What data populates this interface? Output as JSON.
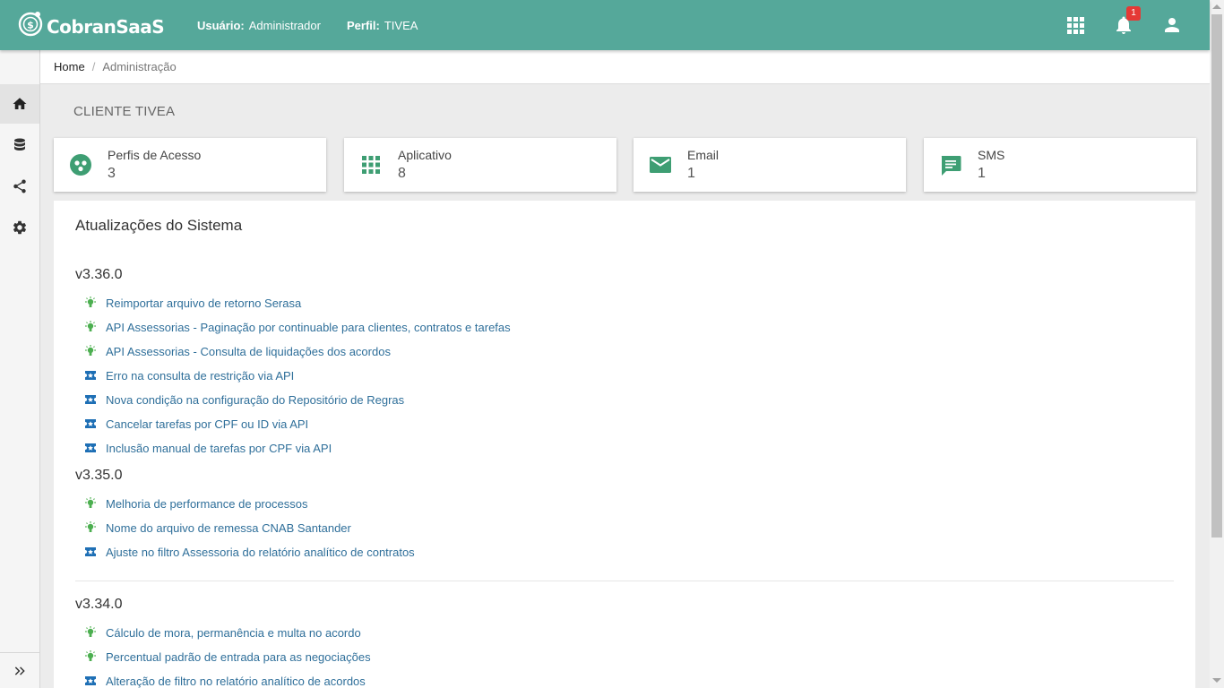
{
  "header": {
    "brand": "CobranSaaS",
    "user_label": "Usuário:",
    "user_value": "Administrador",
    "profile_label": "Perfil:",
    "profile_value": "TIVEA",
    "notifications_count": "1",
    "icons": [
      "apps-grid-icon",
      "bell-icon",
      "account-icon"
    ]
  },
  "sidebar": {
    "items": [
      {
        "name": "home",
        "icon": "home-icon",
        "active": true
      },
      {
        "name": "database",
        "icon": "database-icon"
      },
      {
        "name": "share",
        "icon": "share-icon"
      },
      {
        "name": "settings",
        "icon": "gear-icon"
      }
    ],
    "expand_icon": "double-chevron-right-icon"
  },
  "breadcrumb": {
    "home": "Home",
    "separator": "/",
    "current": "Administração"
  },
  "client_title": "CLIENTE TIVEA",
  "cards": [
    {
      "label": "Perfis de Acesso",
      "value": "3",
      "icon": "group-circle-icon"
    },
    {
      "label": "Aplicativo",
      "value": "8",
      "icon": "apps-grid-icon"
    },
    {
      "label": "Email",
      "value": "1",
      "icon": "mail-icon"
    },
    {
      "label": "SMS",
      "value": "1",
      "icon": "chat-icon"
    }
  ],
  "updates": {
    "title": "Atualizações do Sistema",
    "versions": [
      {
        "version": "v3.36.0",
        "items": [
          {
            "type": "feature",
            "text": "Reimportar arquivo de retorno Serasa"
          },
          {
            "type": "feature",
            "text": "API Assessorias - Paginação por continuable para clientes, contratos e tarefas"
          },
          {
            "type": "feature",
            "text": "API Assessorias - Consulta de liquidações dos acordos"
          },
          {
            "type": "fix",
            "text": "Erro na consulta de restrição via API"
          },
          {
            "type": "fix",
            "text": "Nova condição na configuração do Repositório de Regras"
          },
          {
            "type": "fix",
            "text": "Cancelar tarefas por CPF ou ID via API"
          },
          {
            "type": "fix",
            "text": "Inclusão manual de tarefas por CPF via API"
          }
        ]
      },
      {
        "version": "v3.35.0",
        "items": [
          {
            "type": "feature",
            "text": "Melhoria de performance de processos"
          },
          {
            "type": "feature",
            "text": "Nome do arquivo de remessa CNAB Santander"
          },
          {
            "type": "fix",
            "text": "Ajuste no filtro Assessoria do relatório analítico de contratos"
          }
        ]
      },
      {
        "version": "v3.34.0",
        "items": [
          {
            "type": "feature",
            "text": "Cálculo de mora, permanência e multa no acordo"
          },
          {
            "type": "feature",
            "text": "Percentual padrão de entrada para as negociações"
          },
          {
            "type": "fix",
            "text": "Alteração de filtro no relatório analítico de acordos"
          }
        ]
      }
    ]
  },
  "colors": {
    "header": "#55a89a",
    "accent_green": "#3e9e73",
    "link": "#2f6f9a",
    "feature_icon": "#4caf50",
    "fix_icon": "#1e6fb5",
    "badge": "#e53935"
  }
}
